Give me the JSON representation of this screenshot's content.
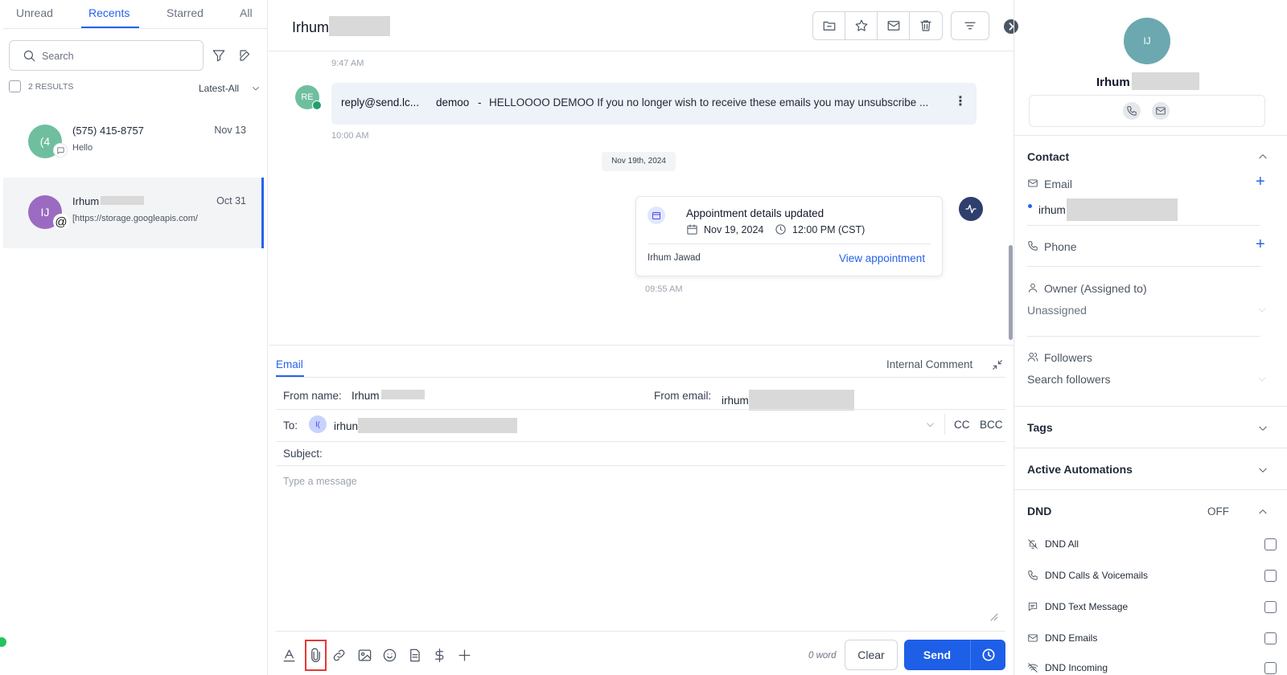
{
  "left": {
    "tabs": [
      "Unread",
      "Recents",
      "Starred",
      "All"
    ],
    "search_placeholder": "Search",
    "results_label": "2 RESULTS",
    "sort_label": "Latest-All",
    "conversations": [
      {
        "avatar": "(4",
        "name": "(575) 415-8757",
        "date": "Nov 13",
        "preview": "Hello",
        "avatar_color": "#6fbf9f"
      },
      {
        "avatar": "IJ",
        "name": "Irhum",
        "date": "Oct 31",
        "preview": "[https://storage.googleapis.com/",
        "avatar_color": "#9b6bc1"
      }
    ]
  },
  "center": {
    "title": "Irhum",
    "time_top": "9:47 AM",
    "email_message": {
      "avatar": "RE",
      "sender": "reply@send.lc...",
      "subject": "demoo",
      "separator": "-",
      "snippet": "HELLOOOO DEMOO If you no longer wish to receive these emails you may unsubscribe ...",
      "time": "10:00 AM"
    },
    "date_divider": "Nov 19th, 2024",
    "appointment": {
      "title": "Appointment details updated",
      "date": "Nov 19, 2024",
      "time": "12:00 PM (CST)",
      "by": "Irhum Jawad",
      "link": "View appointment",
      "timestamp": "09:55 AM"
    },
    "composer": {
      "tab_email": "Email",
      "tab_internal": "Internal Comment",
      "from_name_label": "From name:",
      "from_name_value": "Irhum",
      "from_email_label": "From email:",
      "from_email_value": "irhum",
      "to_label": "To:",
      "to_chip": "I(",
      "to_value": "irhun",
      "cc": "CC",
      "bcc": "BCC",
      "subject_label": "Subject:",
      "message_placeholder": "Type a message",
      "word_count": "0 word",
      "clear": "Clear",
      "send": "Send"
    }
  },
  "right": {
    "avatar": "IJ",
    "name": "Irhum",
    "contact_title": "Contact",
    "email_label": "Email",
    "email_value": "irhum",
    "phone_label": "Phone",
    "owner_label": "Owner (Assigned to)",
    "owner_value": "Unassigned",
    "followers_label": "Followers",
    "followers_placeholder": "Search followers",
    "tags_title": "Tags",
    "automations_title": "Active Automations",
    "dnd_title": "DND",
    "dnd_state": "OFF",
    "dnd_items": [
      "DND All",
      "DND Calls & Voicemails",
      "DND Text Message",
      "DND Emails",
      "DND Incoming"
    ]
  },
  "colors": {
    "accent": "#2563eb",
    "send": "#1d5fe6",
    "highlight_border": "#e53935"
  }
}
